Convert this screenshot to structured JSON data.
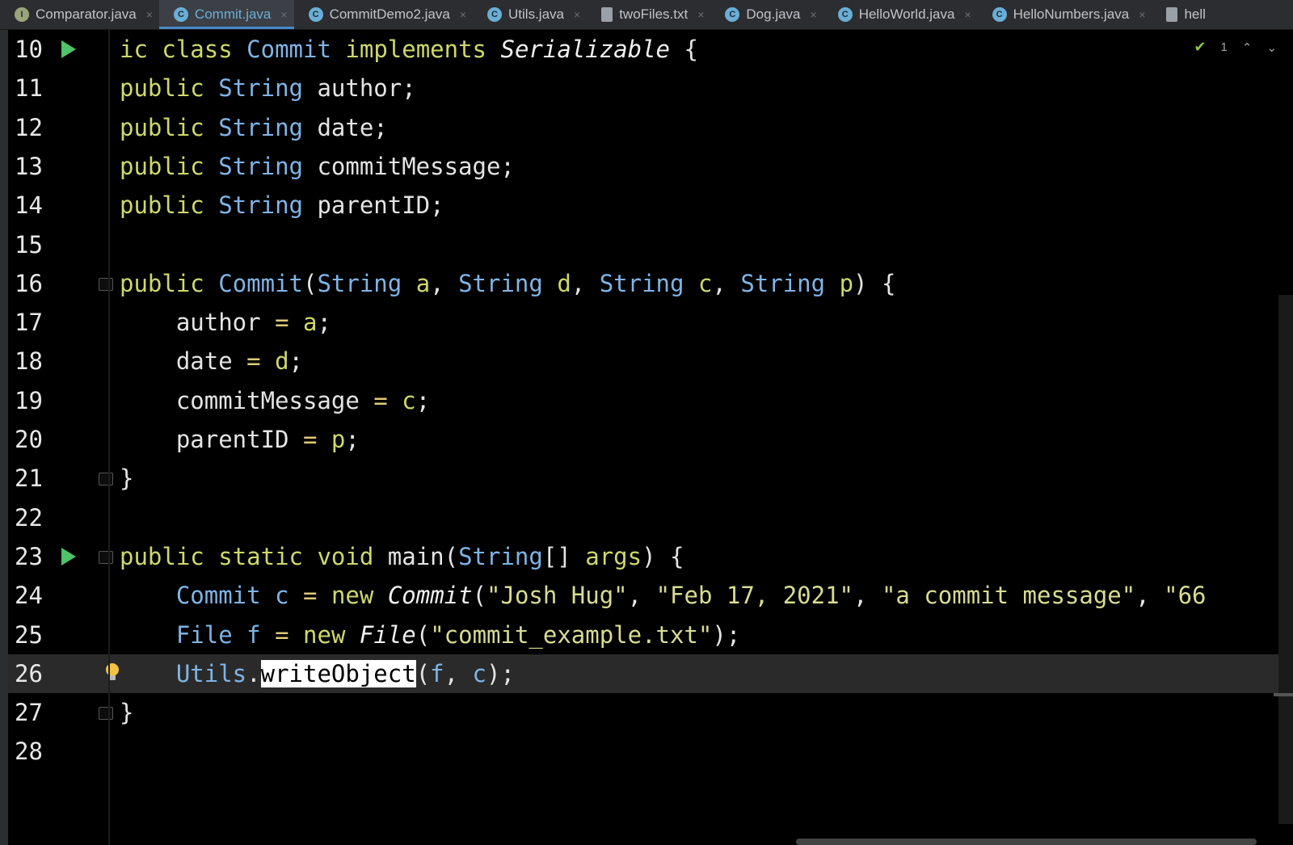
{
  "tabs": [
    {
      "label": "Comparator.java",
      "icon": "interface-icon",
      "icon_letter": "I",
      "icon_color": "#9aa57a",
      "active": false
    },
    {
      "label": "Commit.java",
      "icon": "class-icon",
      "icon_letter": "C",
      "icon_color": "#6aaed6",
      "active": true
    },
    {
      "label": "CommitDemo2.java",
      "icon": "class-icon",
      "icon_letter": "C",
      "icon_color": "#6aaed6",
      "active": false
    },
    {
      "label": "Utils.java",
      "icon": "class-icon",
      "icon_letter": "C",
      "icon_color": "#6aaed6",
      "active": false
    },
    {
      "label": "twoFiles.txt",
      "icon": "text-file-icon",
      "icon_letter": "",
      "icon_color": "#9aa0a8",
      "active": false
    },
    {
      "label": "Dog.java",
      "icon": "class-icon",
      "icon_letter": "C",
      "icon_color": "#6aaed6",
      "active": false
    },
    {
      "label": "HelloWorld.java",
      "icon": "class-icon",
      "icon_letter": "C",
      "icon_color": "#6aaed6",
      "active": false
    },
    {
      "label": "HelloNumbers.java",
      "icon": "class-icon",
      "icon_letter": "C",
      "icon_color": "#6aaed6",
      "active": false
    },
    {
      "label": "hell",
      "icon": "text-file-icon",
      "icon_letter": "",
      "icon_color": "#9aa0a8",
      "active": false
    }
  ],
  "inspection": {
    "count": "1",
    "up": "⌃",
    "down": "⌄"
  },
  "editor": {
    "current_line": 26,
    "lines": [
      {
        "num": "10",
        "code": "ic class Commit implements Serializable {"
      },
      {
        "num": "11",
        "code": "public String author;"
      },
      {
        "num": "12",
        "code": "public String date;"
      },
      {
        "num": "13",
        "code": "public String commitMessage;"
      },
      {
        "num": "14",
        "code": "public String parentID;"
      },
      {
        "num": "15",
        "code": ""
      },
      {
        "num": "16",
        "code": "public Commit(String a, String d, String c, String p) {"
      },
      {
        "num": "17",
        "code": "    author = a;"
      },
      {
        "num": "18",
        "code": "    date = d;"
      },
      {
        "num": "19",
        "code": "    commitMessage = c;"
      },
      {
        "num": "20",
        "code": "    parentID = p;"
      },
      {
        "num": "21",
        "code": "}"
      },
      {
        "num": "22",
        "code": ""
      },
      {
        "num": "23",
        "code": "public static void main(String[] args) {"
      },
      {
        "num": "24",
        "code": "    Commit c = new Commit(\"Josh Hug\", \"Feb 17, 2021\", \"a commit message\", \"66"
      },
      {
        "num": "25",
        "code": "    File f = new File(\"commit_example.txt\");"
      },
      {
        "num": "26",
        "code": "    Utils.writeObject(f, c);"
      },
      {
        "num": "27",
        "code": "}"
      },
      {
        "num": "28",
        "code": ""
      }
    ]
  }
}
